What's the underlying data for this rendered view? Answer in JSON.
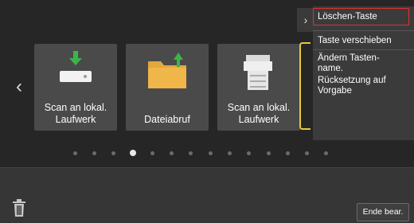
{
  "tiles": [
    {
      "label_line1": "Scan an lokal.",
      "label_line2": "Laufwerk",
      "icon": "scan-to-drive-icon"
    },
    {
      "label_line1": "Dateiabruf",
      "label_line2": "",
      "icon": "folder-upload-icon"
    },
    {
      "label_line1": "Scan an lokal.",
      "label_line2": "Laufwerk",
      "icon": "printer-icon"
    }
  ],
  "pagination": {
    "total": 14,
    "active_index": 3
  },
  "context_menu": {
    "items": [
      {
        "label": "Löschen-Taste",
        "selected": true
      },
      {
        "label": "Taste verschieben",
        "selected": false
      },
      {
        "label": "Ändern Tasten-name.",
        "selected": false
      },
      {
        "label": "Rücksetzung auf Vorgabe",
        "selected": false
      }
    ]
  },
  "footer": {
    "end_button_label": "Ende bear."
  },
  "colors": {
    "selection_border": "#e03030",
    "drag_bracket": "#e8c93a",
    "background": "#262626"
  }
}
